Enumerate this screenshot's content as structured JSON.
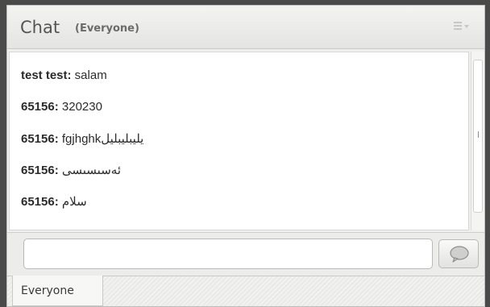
{
  "header": {
    "title": "Chat",
    "scope": "(Everyone)",
    "menu_icon": "menu-icon"
  },
  "messages": [
    {
      "sender": "test test:",
      "text": " salam"
    },
    {
      "sender": "65156:",
      "text": " 320230"
    },
    {
      "sender": "65156:",
      "text": " fgjhghkیلیبلیبلیل"
    },
    {
      "sender": "65156:",
      "text": " ئەسىسىسى"
    },
    {
      "sender": "65156:",
      "text": " سلام"
    }
  ],
  "input": {
    "value": "",
    "placeholder": ""
  },
  "send_icon": "speech-bubble-icon",
  "tabs": [
    {
      "label": "Everyone",
      "active": true
    }
  ],
  "colors": {
    "frame": "#4a4a4a",
    "panel": "#efefed",
    "text": "#2b2b2b"
  }
}
